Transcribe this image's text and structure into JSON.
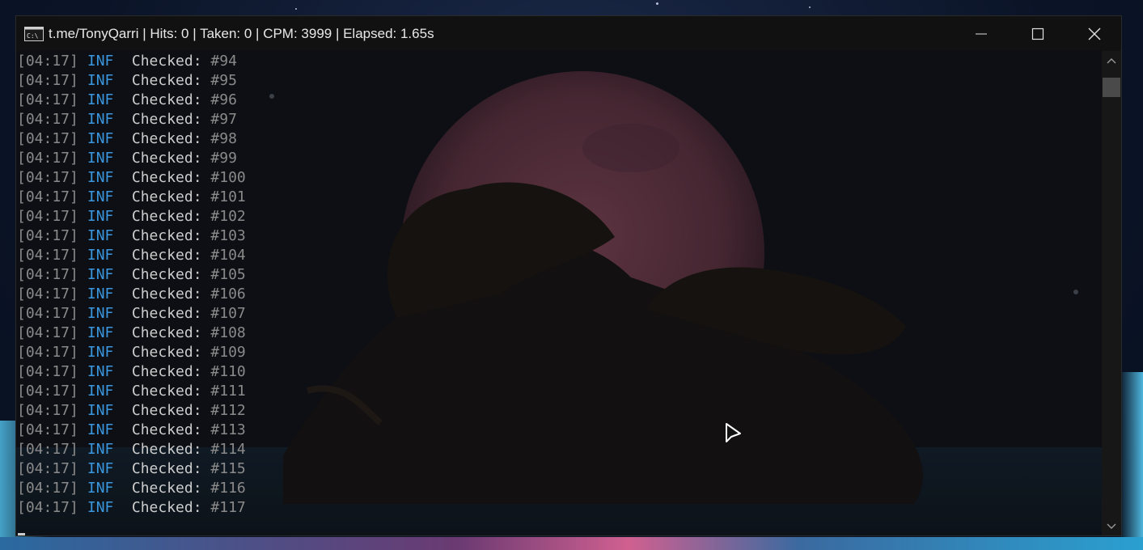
{
  "window": {
    "title": "t.me/TonyQarri | Hits: 0 | Taken: 0 | CPM: 3999 | Elapsed:  1.65s",
    "controls": [
      "minimize-icon",
      "maximize-icon",
      "close-icon"
    ]
  },
  "console": {
    "colors": {
      "timestamp": "#8a8a8a",
      "level": "#3a96dd",
      "label": "#cccccc",
      "number": "#8a8a8a",
      "background": "#0c0c0c"
    },
    "lines": [
      {
        "time": "[04:17]",
        "level": "INF",
        "label": "Checked:",
        "value": "#94"
      },
      {
        "time": "[04:17]",
        "level": "INF",
        "label": "Checked:",
        "value": "#95"
      },
      {
        "time": "[04:17]",
        "level": "INF",
        "label": "Checked:",
        "value": "#96"
      },
      {
        "time": "[04:17]",
        "level": "INF",
        "label": "Checked:",
        "value": "#97"
      },
      {
        "time": "[04:17]",
        "level": "INF",
        "label": "Checked:",
        "value": "#98"
      },
      {
        "time": "[04:17]",
        "level": "INF",
        "label": "Checked:",
        "value": "#99"
      },
      {
        "time": "[04:17]",
        "level": "INF",
        "label": "Checked:",
        "value": "#100"
      },
      {
        "time": "[04:17]",
        "level": "INF",
        "label": "Checked:",
        "value": "#101"
      },
      {
        "time": "[04:17]",
        "level": "INF",
        "label": "Checked:",
        "value": "#102"
      },
      {
        "time": "[04:17]",
        "level": "INF",
        "label": "Checked:",
        "value": "#103"
      },
      {
        "time": "[04:17]",
        "level": "INF",
        "label": "Checked:",
        "value": "#104"
      },
      {
        "time": "[04:17]",
        "level": "INF",
        "label": "Checked:",
        "value": "#105"
      },
      {
        "time": "[04:17]",
        "level": "INF",
        "label": "Checked:",
        "value": "#106"
      },
      {
        "time": "[04:17]",
        "level": "INF",
        "label": "Checked:",
        "value": "#107"
      },
      {
        "time": "[04:17]",
        "level": "INF",
        "label": "Checked:",
        "value": "#108"
      },
      {
        "time": "[04:17]",
        "level": "INF",
        "label": "Checked:",
        "value": "#109"
      },
      {
        "time": "[04:17]",
        "level": "INF",
        "label": "Checked:",
        "value": "#110"
      },
      {
        "time": "[04:17]",
        "level": "INF",
        "label": "Checked:",
        "value": "#111"
      },
      {
        "time": "[04:17]",
        "level": "INF",
        "label": "Checked:",
        "value": "#112"
      },
      {
        "time": "[04:17]",
        "level": "INF",
        "label": "Checked:",
        "value": "#113"
      },
      {
        "time": "[04:17]",
        "level": "INF",
        "label": "Checked:",
        "value": "#114"
      },
      {
        "time": "[04:17]",
        "level": "INF",
        "label": "Checked:",
        "value": "#115"
      },
      {
        "time": "[04:17]",
        "level": "INF",
        "label": "Checked:",
        "value": "#116"
      },
      {
        "time": "[04:17]",
        "level": "INF",
        "label": "Checked:",
        "value": "#117"
      }
    ]
  }
}
